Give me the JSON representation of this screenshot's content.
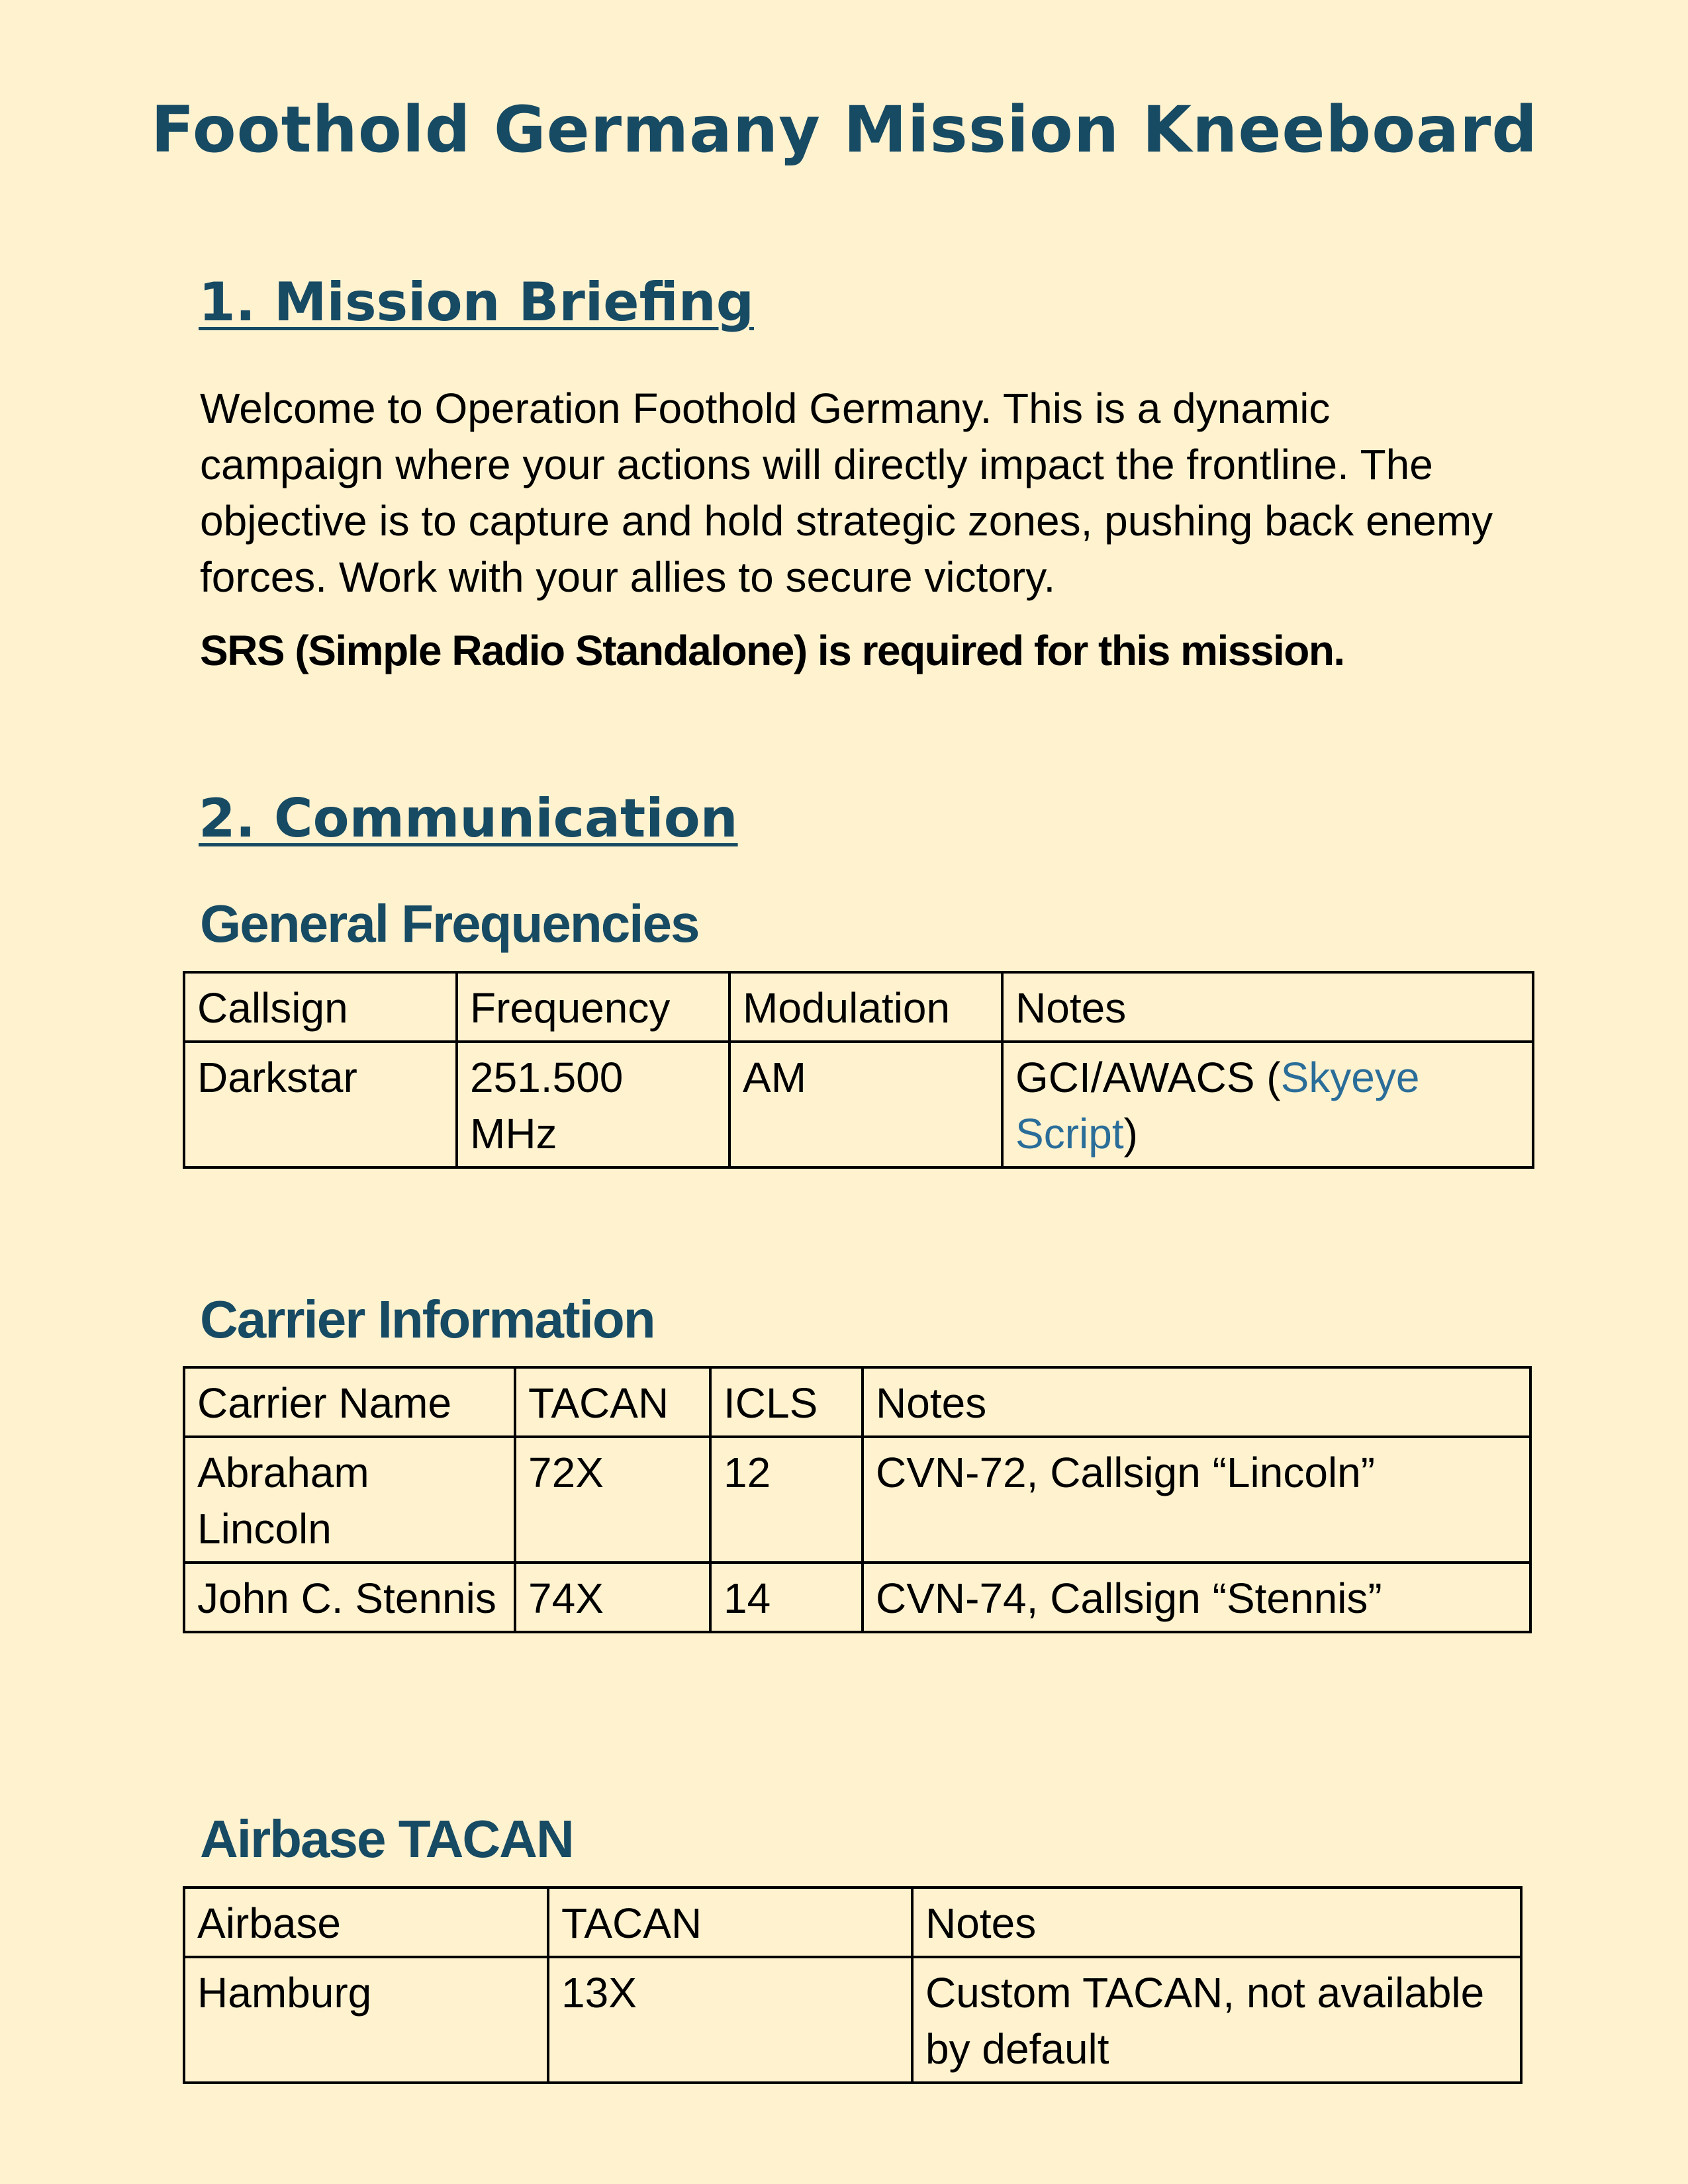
{
  "title": "Foothold Germany Mission Kneeboard",
  "sections": {
    "briefing": {
      "heading": "1. Mission Briefing",
      "paragraph": "Welcome to Operation Foothold Germany. This is a dynamic campaign where your actions will directly impact the frontline. The objective is to capture and hold strategic zones, pushing back enemy forces. Work with your allies to secure victory.",
      "srs_note": "SRS (Simple Radio Standalone) is required for this mission."
    },
    "communication": {
      "heading": "2. Communication",
      "general_frequencies": {
        "heading": "General Frequencies",
        "headers": [
          "Callsign",
          "Frequency",
          "Modulation",
          "Notes"
        ],
        "rows": [
          {
            "callsign": "Darkstar",
            "frequency": "251.500 MHz",
            "modulation": "AM",
            "notes_prefix": "GCI/AWACS (",
            "notes_link": "Skyeye Script",
            "notes_suffix": ")"
          }
        ]
      },
      "carrier_information": {
        "heading": "Carrier Information",
        "headers": [
          "Carrier Name",
          "TACAN",
          "ICLS",
          "Notes"
        ],
        "rows": [
          {
            "name": "Abraham Lincoln",
            "tacan": "72X",
            "icls": "12",
            "notes": "CVN-72, Callsign “Lincoln”"
          },
          {
            "name": "John C. Stennis",
            "tacan": "74X",
            "icls": "14",
            "notes": "CVN-74, Callsign “Stennis”"
          }
        ]
      },
      "airbase_tacan": {
        "heading": "Airbase TACAN",
        "headers": [
          "Airbase",
          "TACAN",
          "Notes"
        ],
        "rows": [
          {
            "airbase": "Hamburg",
            "tacan": "13X",
            "notes": "Custom TACAN, not available by default"
          }
        ]
      }
    }
  },
  "colors": {
    "page_background": "#fff2cf",
    "heading": "#174a63",
    "link": "#2a6d99",
    "text": "#000000"
  }
}
